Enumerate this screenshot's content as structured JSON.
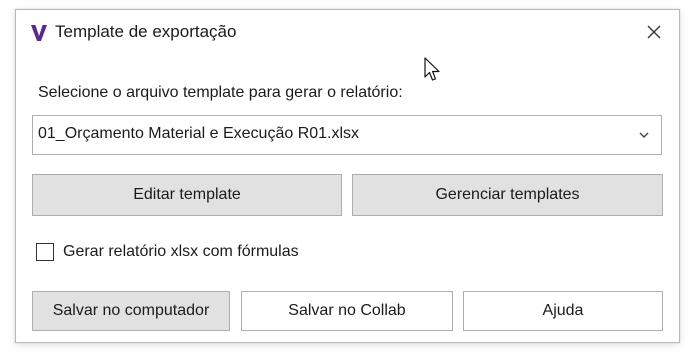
{
  "window": {
    "title": "Template de exportação",
    "icon": "app-logo-icon",
    "close_icon": "close-icon",
    "accent_color": "#5b2a8c"
  },
  "form": {
    "prompt": "Selecione o arquivo template para gerar o relatório:",
    "template_select": {
      "selected": "01_Orçamento Material e Execução R01.xlsx"
    },
    "buttons": {
      "edit": "Editar template",
      "manage": "Gerenciar templates"
    },
    "checkbox": {
      "label": "Gerar relatório xlsx com fórmulas",
      "checked": false
    }
  },
  "footer": {
    "save_pc": "Salvar no computador",
    "save_collab": "Salvar no Collab",
    "help": "Ajuda"
  }
}
